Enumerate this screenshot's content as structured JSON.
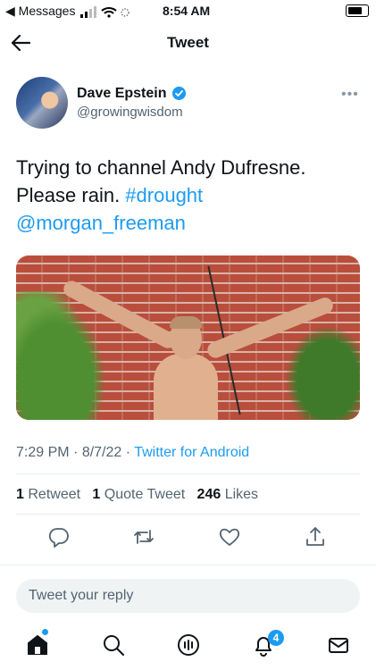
{
  "status_bar": {
    "back_app": "◀ Messages",
    "time": "8:54 AM"
  },
  "header": {
    "title": "Tweet"
  },
  "author": {
    "name": "Dave Epstein",
    "handle": "@growingwisdom"
  },
  "tweet": {
    "text_line1": "Trying to channel Andy Dufresne.",
    "text_plain": "Please rain. ",
    "hashtag": "#drought",
    "mention": "@morgan_freeman"
  },
  "meta": {
    "time": "7:29 PM",
    "date": "8/7/22",
    "source": "Twitter for Android"
  },
  "stats": {
    "retweets_count": "1",
    "retweets_label": "Retweet",
    "quotes_count": "1",
    "quotes_label": "Quote Tweet",
    "likes_count": "246",
    "likes_label": "Likes"
  },
  "actions": [
    "reply-icon",
    "retweet-icon",
    "like-icon",
    "share-icon"
  ],
  "reply": {
    "placeholder": "Tweet your reply"
  },
  "tabbar": {
    "items": [
      "home-icon",
      "search-icon",
      "spaces-icon",
      "notifications-icon",
      "messages-icon"
    ],
    "notifications_badge": "4"
  },
  "colors": {
    "accent": "#1d9bf0",
    "text": "#0f1419",
    "secondary": "#536471"
  }
}
